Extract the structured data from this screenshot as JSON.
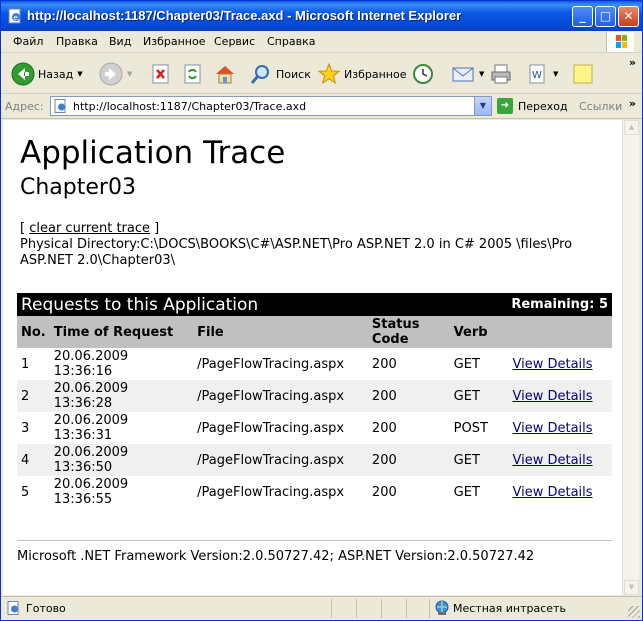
{
  "window": {
    "title": "http://localhost:1187/Chapter03/Trace.axd - Microsoft Internet Explorer"
  },
  "menu": [
    "Файл",
    "Правка",
    "Вид",
    "Избранное",
    "Сервис",
    "Справка"
  ],
  "toolbar": {
    "back_label": "Назад",
    "search_label": "Поиск",
    "favorites_label": "Избранное"
  },
  "address": {
    "label": "Адрес:",
    "url": "http://localhost:1187/Chapter03/Trace.axd",
    "go_label": "Переход",
    "links_label": "Ссылки"
  },
  "page": {
    "title": "Application Trace",
    "subtitle": "Chapter03",
    "clear_open": "[ ",
    "clear_link": "clear current trace",
    "clear_close": " ]",
    "physical_directory": "Physical Directory:C:\\DOCS\\BOOKS\\C#\\ASP.NET\\Pro ASP.NET 2.0 in C# 2005 \\files\\Pro ASP.NET 2.0\\Chapter03\\",
    "requests_title": "Requests to this Application",
    "remaining": "Remaining: 5",
    "columns": [
      "No.",
      "Time of Request",
      "File",
      "Status Code",
      "Verb",
      ""
    ],
    "rows": [
      {
        "no": "1",
        "date": "20.06.2009",
        "time": "13:36:16",
        "file": "/PageFlowTracing.aspx",
        "status": "200",
        "verb": "GET",
        "link": "View Details"
      },
      {
        "no": "2",
        "date": "20.06.2009",
        "time": "13:36:28",
        "file": "/PageFlowTracing.aspx",
        "status": "200",
        "verb": "GET",
        "link": "View Details"
      },
      {
        "no": "3",
        "date": "20.06.2009",
        "time": "13:36:31",
        "file": "/PageFlowTracing.aspx",
        "status": "200",
        "verb": "POST",
        "link": "View Details"
      },
      {
        "no": "4",
        "date": "20.06.2009",
        "time": "13:36:50",
        "file": "/PageFlowTracing.aspx",
        "status": "200",
        "verb": "GET",
        "link": "View Details"
      },
      {
        "no": "5",
        "date": "20.06.2009",
        "time": "13:36:55",
        "file": "/PageFlowTracing.aspx",
        "status": "200",
        "verb": "GET",
        "link": "View Details"
      }
    ],
    "footer": "Microsoft .NET Framework Version:2.0.50727.42; ASP.NET Version:2.0.50727.42"
  },
  "status": {
    "text": "Готово",
    "zone": "Местная интрасеть"
  }
}
